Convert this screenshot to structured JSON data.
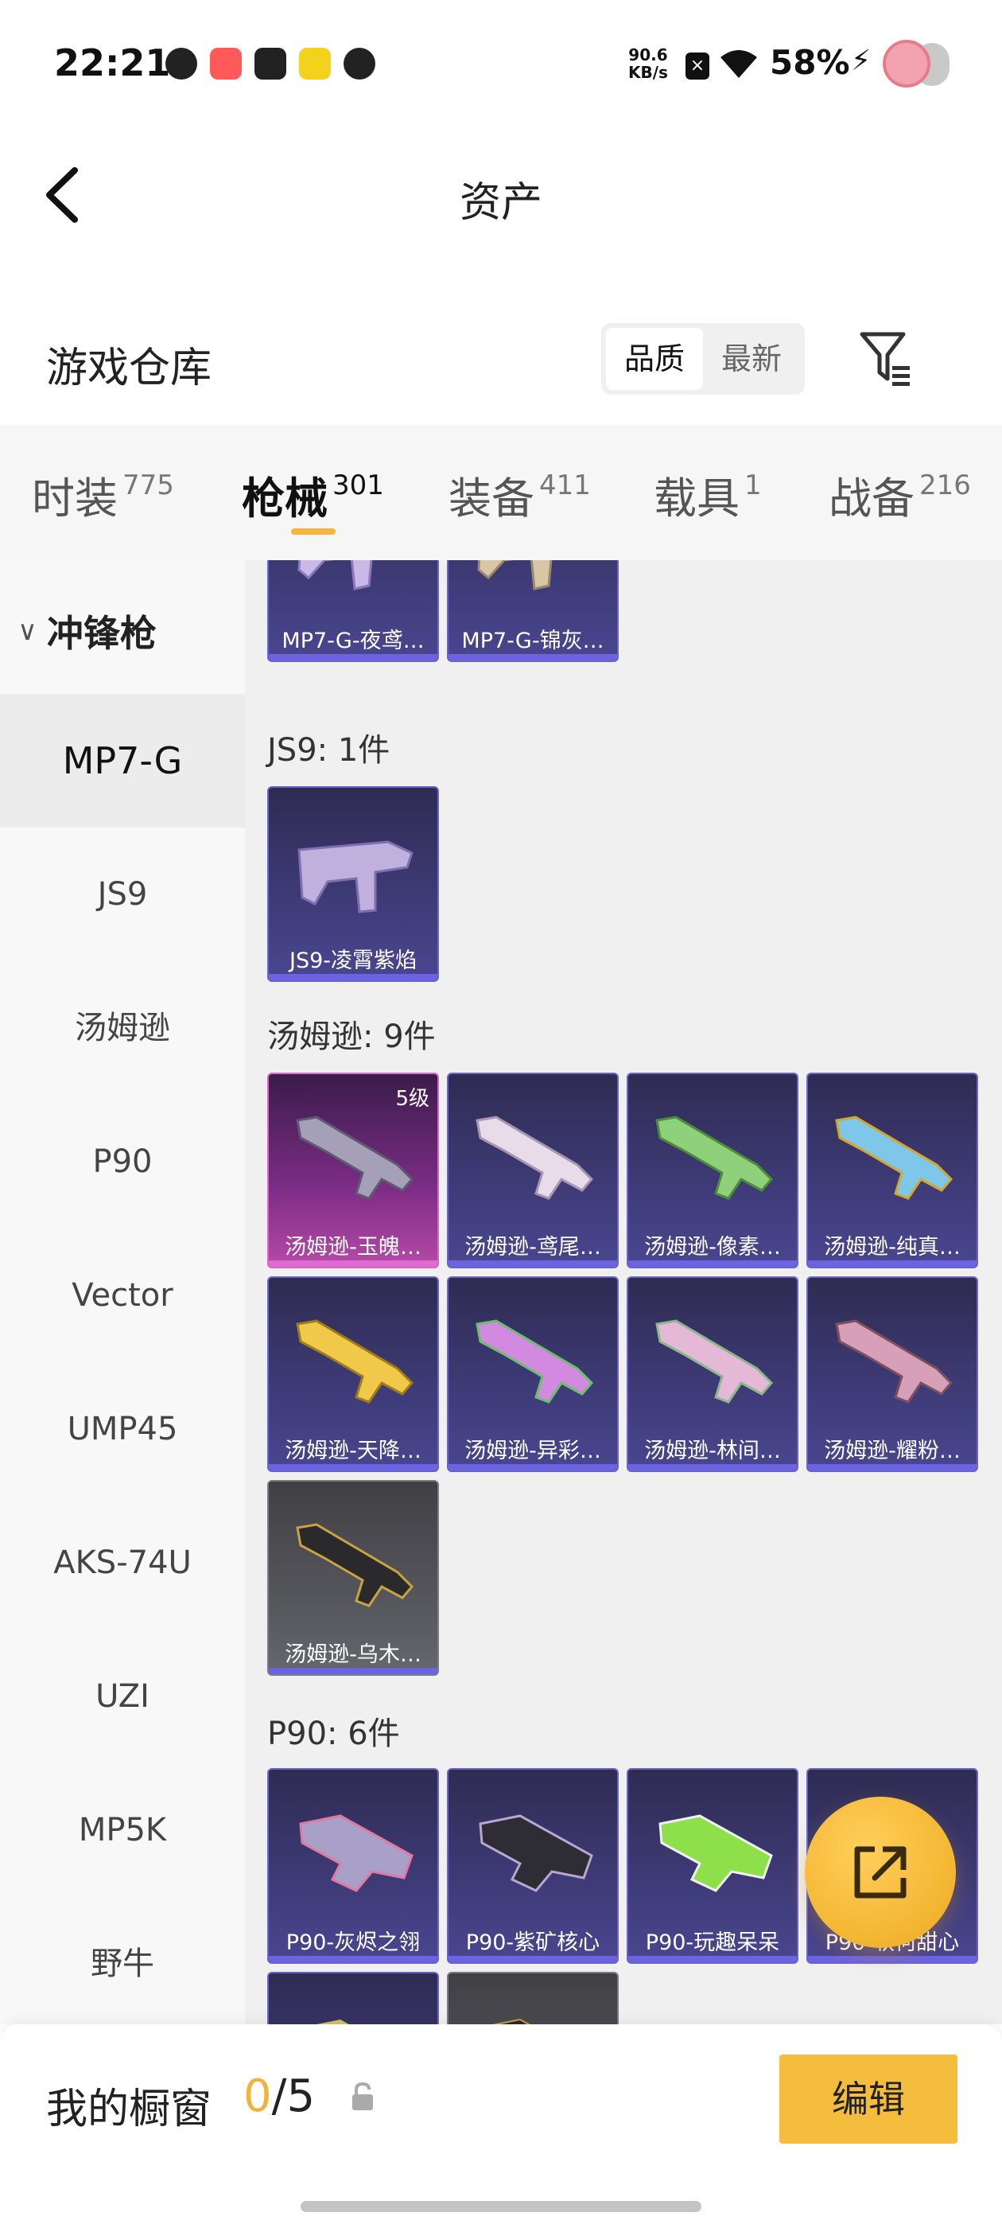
{
  "status_bar": {
    "time": "22:21",
    "speed_value": "90.6",
    "speed_unit": "KB/s",
    "battery": "58%"
  },
  "header": {
    "title": "资产"
  },
  "repo": {
    "title": "游戏仓库",
    "sort_options": [
      "品质",
      "最新"
    ],
    "sort_selected": "品质"
  },
  "tabs": [
    {
      "label": "时装",
      "count": "775"
    },
    {
      "label": "枪械",
      "count": "301",
      "active": true
    },
    {
      "label": "装备",
      "count": "411"
    },
    {
      "label": "载具",
      "count": "1"
    },
    {
      "label": "战备",
      "count": "216"
    }
  ],
  "sidebar": {
    "category": "冲锋枪",
    "items": [
      "MP7-G",
      "JS9",
      "汤姆逊",
      "P90",
      "Vector",
      "UMP45",
      "AKS-74U",
      "UZI",
      "MP5K",
      "野牛"
    ],
    "active": "MP7-G"
  },
  "sections": [
    {
      "title": "",
      "items": [
        "MP7-G-夜鸢…",
        "MP7-G-锦灰…"
      ]
    },
    {
      "title": "JS9: 1件",
      "items": [
        "JS9-凌霄紫焰"
      ]
    },
    {
      "title": "汤姆逊: 9件",
      "items": [
        "汤姆逊-玉魄…",
        "汤姆逊-鸢尾…",
        "汤姆逊-像素…",
        "汤姆逊-纯真…",
        "汤姆逊-天降…",
        "汤姆逊-异彩…",
        "汤姆逊-林间…",
        "汤姆逊-耀粉…",
        "汤姆逊-乌木…"
      ],
      "first_level": "5级"
    },
    {
      "title": "P90: 6件",
      "items": [
        "P90-灰烬之翎",
        "P90-紫矿核心",
        "P90-玩趣呆呆",
        "P90-软何甜心"
      ]
    }
  ],
  "bottom_bar": {
    "title": "我的橱窗",
    "count_current": "0",
    "count_total": "/5",
    "edit_label": "编辑"
  },
  "icons": [
    "back-arrow-icon",
    "filter-icon",
    "share-icon",
    "lock-icon",
    "chevron-down-icon"
  ],
  "colors": {
    "accent": "#f4bd3e",
    "rare_border": "#6a63c9",
    "legendary_border": "#d665c4"
  }
}
